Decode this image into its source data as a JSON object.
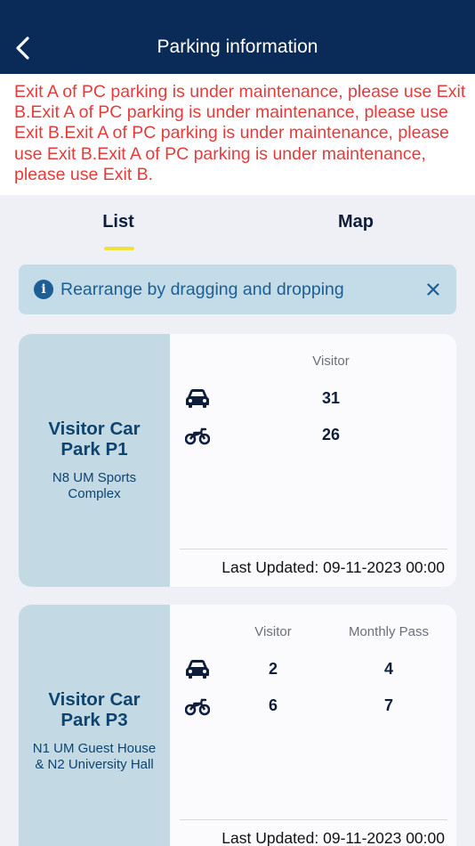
{
  "header": {
    "title": "Parking information"
  },
  "notice": {
    "text": "Exit A of PC parking is under maintenance, please use Exit B.Exit A of PC parking is under maintenance, please use Exit B.Exit A of PC parking is under maintenance, please use Exit B.Exit A of PC parking is under maintenance, please use Exit B."
  },
  "tabs": {
    "list": "List",
    "map": "Map",
    "active": "List"
  },
  "banner": {
    "text": "Rearrange by dragging and dropping"
  },
  "cards": [
    {
      "name": "Visitor Car Park P1",
      "location": "N8 UM Sports Complex",
      "columns": [
        "Visitor"
      ],
      "car": [
        "31"
      ],
      "motorcycle": [
        "26"
      ],
      "updated": "Last Updated: 09-11-2023 00:00"
    },
    {
      "name": "Visitor Car Park P3",
      "location": "N1 UM Guest House & N2 University Hall",
      "columns": [
        "Visitor",
        "Monthly Pass"
      ],
      "car": [
        "2",
        "4"
      ],
      "motorcycle": [
        "6",
        "7"
      ],
      "updated": "Last Updated: 09-11-2023 00:00"
    }
  ],
  "colors": {
    "header": "#0a2a57",
    "notice": "#e63b3b",
    "accent": "#f3e03b",
    "card_left": "#c3dae5"
  }
}
